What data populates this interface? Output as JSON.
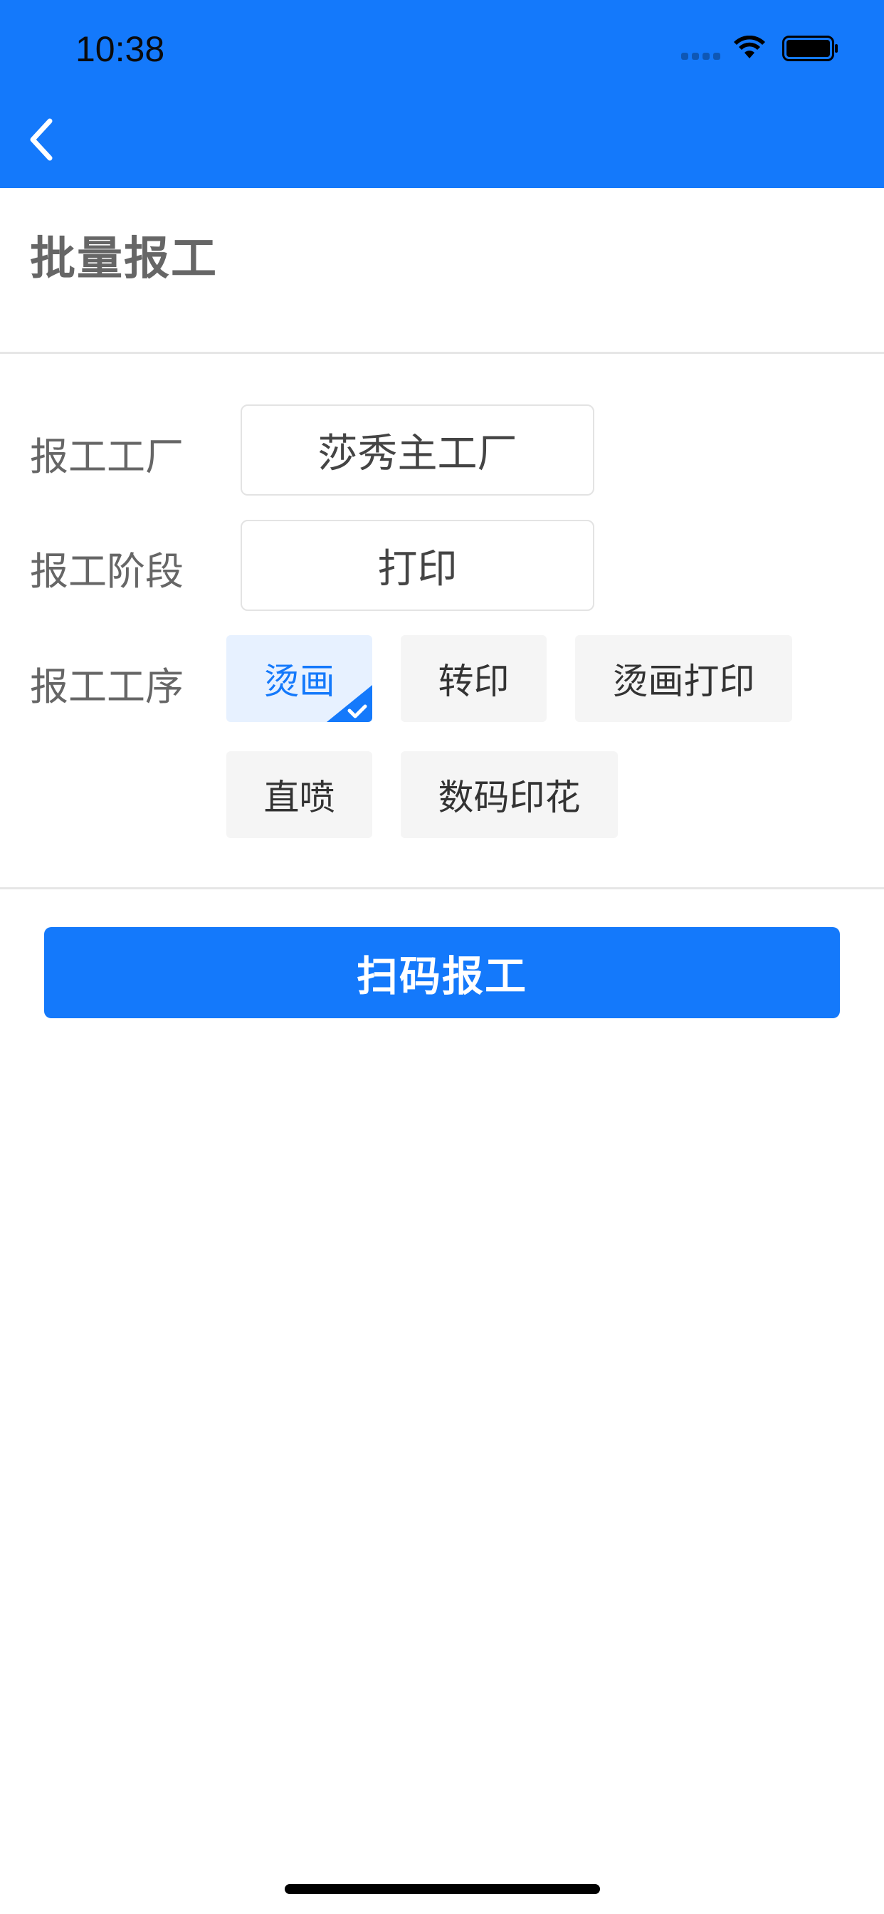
{
  "status_bar": {
    "time": "10:38"
  },
  "nav": {
    "back_icon": "chevron-left-icon"
  },
  "page": {
    "title": "批量报工"
  },
  "form": {
    "factory": {
      "label": "报工工厂",
      "value": "莎秀主工厂"
    },
    "stage": {
      "label": "报工阶段",
      "value": "打印"
    },
    "process": {
      "label": "报工工序",
      "options": [
        {
          "label": "烫画",
          "selected": true
        },
        {
          "label": "转印",
          "selected": false
        },
        {
          "label": "烫画打印",
          "selected": false
        },
        {
          "label": "直喷",
          "selected": false
        },
        {
          "label": "数码印花",
          "selected": false
        }
      ]
    }
  },
  "actions": {
    "scan_label": "扫码报工"
  },
  "colors": {
    "primary": "#1479fb",
    "selected_chip_bg": "#e7f1ff",
    "chip_bg": "#f5f5f5",
    "label_text": "#666666"
  }
}
